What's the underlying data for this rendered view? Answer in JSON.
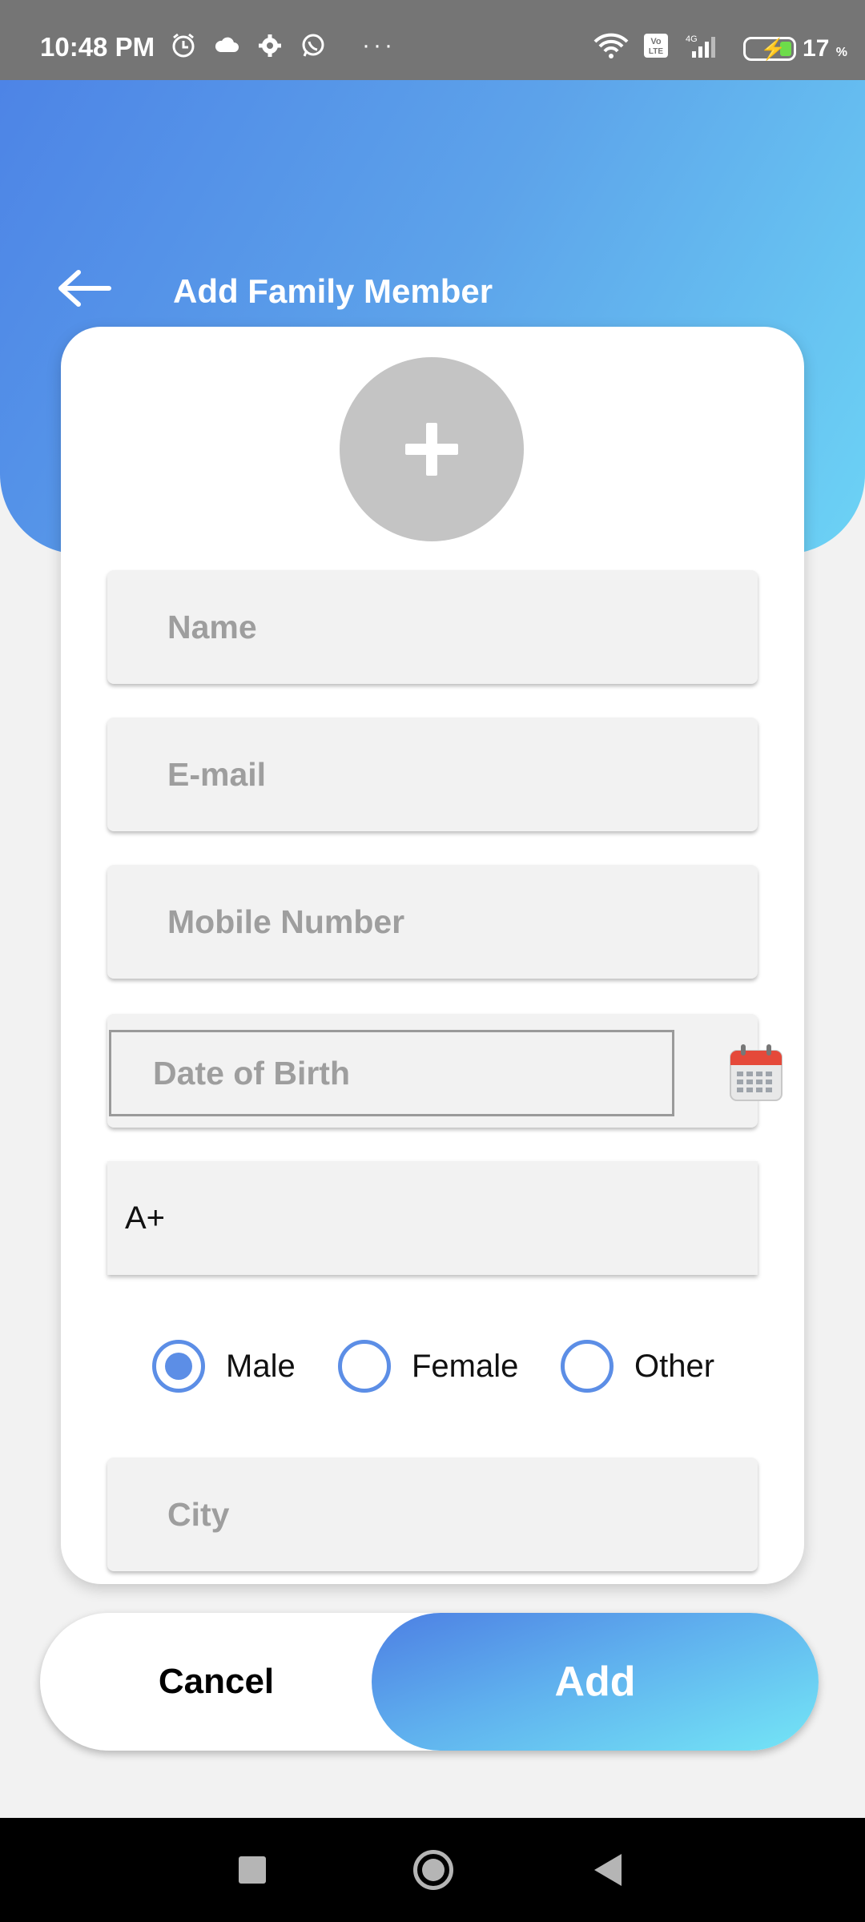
{
  "status_bar": {
    "time": "10:48 PM",
    "icons_left": [
      "alarm-icon",
      "cloud-icon",
      "settings-icon",
      "whatsapp-icon"
    ],
    "more": "···",
    "battery_pct": "17",
    "battery_unit": "%",
    "network": "4G",
    "volte": "VoLTE"
  },
  "header": {
    "title": "Add Family Member",
    "back_icon": "back-arrow-icon",
    "gradient": [
      "#4d84e6",
      "#6cd3f5"
    ]
  },
  "form": {
    "avatar_icon": "plus-icon",
    "name_placeholder": "Name",
    "email_placeholder": "E-mail",
    "mobile_placeholder": "Mobile Number",
    "dob_placeholder": "Date of Birth",
    "calendar_icon": "calendar-icon",
    "blood_group": "A+",
    "gender": {
      "options": [
        "Male",
        "Female",
        "Other"
      ],
      "selected": "Male"
    },
    "city_placeholder": "City"
  },
  "actions": {
    "cancel_label": "Cancel",
    "add_label": "Add"
  },
  "colors": {
    "accent": "#5c8ee6",
    "background": "#f2f2f2"
  }
}
